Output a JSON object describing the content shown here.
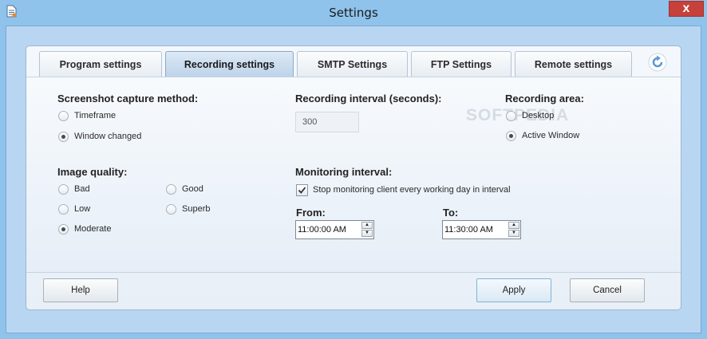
{
  "window": {
    "title": "Settings",
    "close_glyph": "x",
    "app_icon": "document-icon"
  },
  "tabs": [
    {
      "label": "Program settings",
      "active": false
    },
    {
      "label": "Recording settings",
      "active": true
    },
    {
      "label": "SMTP Settings",
      "active": false
    },
    {
      "label": "FTP Settings",
      "active": false
    },
    {
      "label": "Remote settings",
      "active": false
    }
  ],
  "refresh_icon": "refresh-icon",
  "capture": {
    "heading": "Screenshot capture method:",
    "options": [
      {
        "label": "Timeframe",
        "checked": false
      },
      {
        "label": "Window changed",
        "checked": true
      }
    ]
  },
  "recording_interval": {
    "heading": "Recording interval (seconds):",
    "value": "300"
  },
  "recording_area": {
    "heading": "Recording area:",
    "options": [
      {
        "label": "Desktop",
        "checked": false
      },
      {
        "label": "Active Window",
        "checked": true
      }
    ]
  },
  "image_quality": {
    "heading": "Image quality:",
    "options": [
      {
        "label": "Bad",
        "checked": false
      },
      {
        "label": "Good",
        "checked": false
      },
      {
        "label": "Low",
        "checked": false
      },
      {
        "label": "Superb",
        "checked": false
      },
      {
        "label": "Moderate",
        "checked": true
      }
    ]
  },
  "monitoring": {
    "heading": "Monitoring interval:",
    "checkbox_label": "Stop monitoring client  every working day in interval",
    "checkbox_checked": true,
    "from_label": "From:",
    "from_value": "11:00:00 AM",
    "to_label": "To:",
    "to_value": "11:30:00 AM"
  },
  "buttons": {
    "help": "Help",
    "apply": "Apply",
    "cancel": "Cancel"
  },
  "watermark": "SOFTPEDIA"
}
